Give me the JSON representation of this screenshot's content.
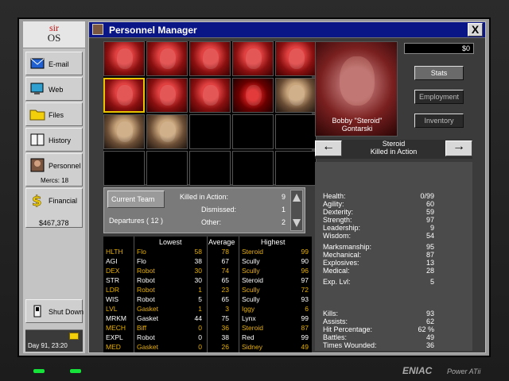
{
  "os": {
    "logo_top": "sir",
    "logo_bottom": "OS"
  },
  "sidebar": {
    "email": "E-mail",
    "web": "Web",
    "files": "Files",
    "history": "History",
    "personnel": "Personnel",
    "mercs": "Mercs: 18",
    "financial": "Financial",
    "balance": "$467,378",
    "shutdown": "Shut Down",
    "clock": "Day 91, 23:20"
  },
  "window": {
    "title": "Personnel Manager",
    "close": "X"
  },
  "team": {
    "current_team": "Current Team",
    "departures": "Departures ( 12 )",
    "killed_label": "Killed in Action:",
    "killed_value": "9",
    "dismissed_label": "Dismissed:",
    "dismissed_value": "1",
    "other_label": "Other:",
    "other_value": "2"
  },
  "stats_table": {
    "headers": {
      "lowest": "Lowest",
      "average": "Average",
      "highest": "Highest"
    },
    "rows": [
      {
        "stat": "HLTH",
        "low_name": "Flo",
        "low": "58",
        "avg": "78",
        "high_name": "Steroid",
        "high": "99",
        "color": "#e8b000"
      },
      {
        "stat": "AGI",
        "low_name": "Flo",
        "low": "38",
        "avg": "67",
        "high_name": "Scully",
        "high": "90",
        "color": "#ffffff"
      },
      {
        "stat": "DEX",
        "low_name": "Robot",
        "low": "30",
        "avg": "74",
        "high_name": "Scully",
        "high": "96",
        "color": "#e8b000"
      },
      {
        "stat": "STR",
        "low_name": "Robot",
        "low": "30",
        "avg": "65",
        "high_name": "Steroid",
        "high": "97",
        "color": "#ffffff"
      },
      {
        "stat": "LDR",
        "low_name": "Robot",
        "low": "1",
        "avg": "23",
        "high_name": "Scully",
        "high": "72",
        "color": "#e8b000"
      },
      {
        "stat": "WIS",
        "low_name": "Robot",
        "low": "5",
        "avg": "65",
        "high_name": "Scully",
        "high": "93",
        "color": "#ffffff"
      },
      {
        "stat": "LVL",
        "low_name": "Gasket",
        "low": "1",
        "avg": "3",
        "high_name": "Iggy",
        "high": "6",
        "color": "#e8b000"
      },
      {
        "stat": "MRKM",
        "low_name": "Gasket",
        "low": "44",
        "avg": "75",
        "high_name": "Lynx",
        "high": "99",
        "color": "#ffffff"
      },
      {
        "stat": "MECH",
        "low_name": "Biff",
        "low": "0",
        "avg": "36",
        "high_name": "Steroid",
        "high": "87",
        "color": "#e8b000"
      },
      {
        "stat": "EXPL",
        "low_name": "Robot",
        "low": "0",
        "avg": "38",
        "high_name": "Red",
        "high": "99",
        "color": "#ffffff"
      },
      {
        "stat": "MED",
        "low_name": "Gasket",
        "low": "0",
        "avg": "26",
        "high_name": "Sidney",
        "high": "49",
        "color": "#e8b000"
      }
    ]
  },
  "merc": {
    "name_line1": "Bobby \"Steroid\"",
    "name_line2": "Gontarski",
    "money": "$0",
    "stats_btn": "Stats",
    "employment_btn": "Employment",
    "inventory_btn": "Inventory",
    "nickname": "Steroid",
    "status": "Killed in Action",
    "prev_icon": "left-arrow",
    "next_icon": "right-arrow",
    "attributes": [
      {
        "label": "Health:",
        "value": "0/99"
      },
      {
        "label": "Agility:",
        "value": "60"
      },
      {
        "label": "Dexterity:",
        "value": "59"
      },
      {
        "label": "Strength:",
        "value": "97"
      },
      {
        "label": "Leadership:",
        "value": "9"
      },
      {
        "label": "Wisdom:",
        "value": "54"
      },
      {
        "label": "Marksmanship:",
        "value": "95"
      },
      {
        "label": "Mechanical:",
        "value": "87"
      },
      {
        "label": "Explosives:",
        "value": "13"
      },
      {
        "label": "Medical:",
        "value": "28"
      },
      {
        "label": "Exp. Lvl:",
        "value": "5"
      },
      {
        "label": "Kills:",
        "value": "93"
      },
      {
        "label": "Assists:",
        "value": "62"
      },
      {
        "label": "Hit Percentage:",
        "value": "62 %"
      },
      {
        "label": "Battles:",
        "value": "49"
      },
      {
        "label": "Times Wounded:",
        "value": "36"
      }
    ]
  },
  "brand": {
    "name": "ENIAC",
    "model": "Power ATii"
  }
}
